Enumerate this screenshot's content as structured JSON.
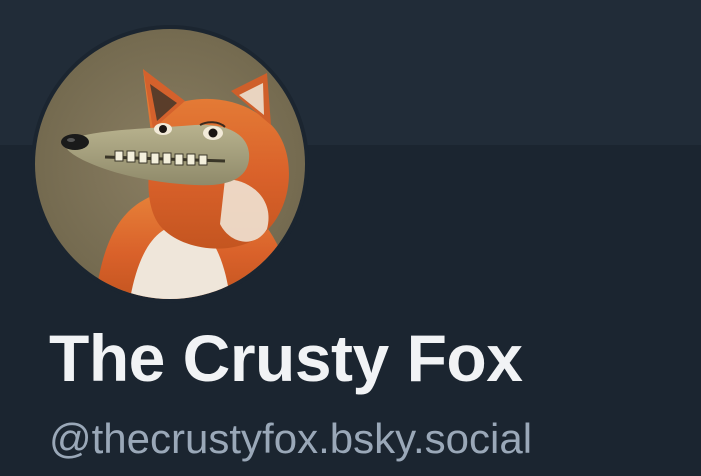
{
  "profile": {
    "display_name": "The Crusty Fox",
    "handle": "@thecrustyfox.bsky.social",
    "avatar_alt": "fox-with-crocodile-snout-avatar"
  },
  "colors": {
    "banner": "#212c38",
    "background": "#1b2530",
    "name_text": "#f1f3f5",
    "handle_text": "#9aa8b8"
  }
}
